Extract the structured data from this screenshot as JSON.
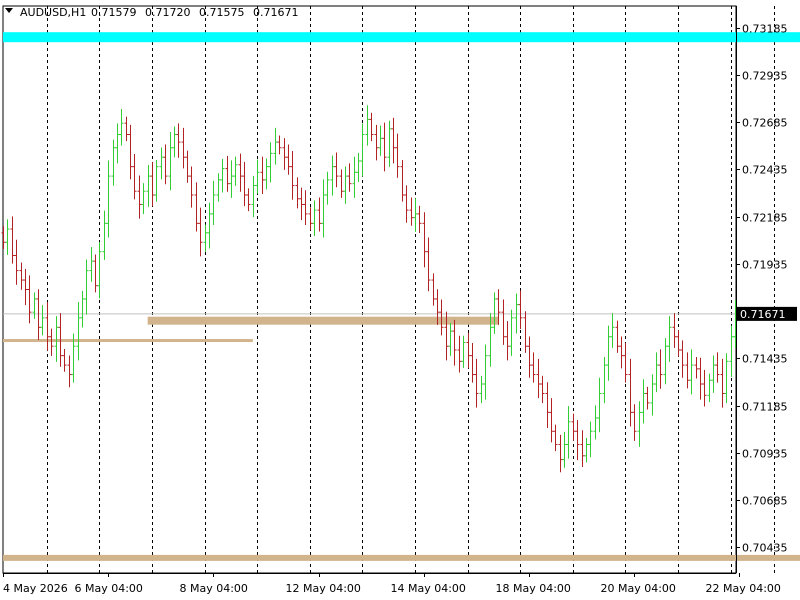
{
  "chart_data": {
    "type": "bar",
    "style": "ohlc-bars",
    "title": "AUDUSD,H1",
    "ohlc_header": {
      "open": "0.71579",
      "high": "0.71720",
      "low": "0.71575",
      "close": "0.71671"
    },
    "current_price": 0.71671,
    "current_price_label": "0.71671",
    "ylim": [
      0.703,
      0.733
    ],
    "y_ticks": [
      {
        "value": 0.73185,
        "label": "0.73185"
      },
      {
        "value": 0.72935,
        "label": "0.72935"
      },
      {
        "value": 0.72685,
        "label": "0.72685"
      },
      {
        "value": 0.72435,
        "label": "0.72435"
      },
      {
        "value": 0.72185,
        "label": "0.72185"
      },
      {
        "value": 0.71935,
        "label": "0.71935"
      },
      {
        "value": 0.71685,
        "label": "0.71685"
      },
      {
        "value": 0.71435,
        "label": "0.71435"
      },
      {
        "value": 0.71185,
        "label": "0.71185"
      },
      {
        "value": 0.70935,
        "label": "0.70935"
      },
      {
        "value": 0.70685,
        "label": "0.70685"
      },
      {
        "value": 0.70435,
        "label": "0.70435"
      }
    ],
    "x_ticks": [
      {
        "bar": 0,
        "label": "4 May 2026"
      },
      {
        "bar": 24,
        "label": "6 May 04:00"
      },
      {
        "bar": 48,
        "label": "8 May 04:00"
      },
      {
        "bar": 72,
        "label": "12 May 04:00"
      },
      {
        "bar": 96,
        "label": "14 May 04:00"
      },
      {
        "bar": 120,
        "label": "18 May 04:00"
      },
      {
        "bar": 144,
        "label": "20 May 04:00"
      },
      {
        "bar": 168,
        "label": "22 May 04:00"
      }
    ],
    "day_separators": [
      10,
      22,
      34,
      46,
      58,
      70,
      82,
      94,
      106,
      118,
      130,
      142,
      154,
      166,
      176
    ],
    "levels": [
      {
        "value": 0.73135,
        "color": "#00ffff",
        "from_bar": 0,
        "to_bar": 183
      },
      {
        "value": 0.71635,
        "color": "#d2b48c",
        "from_bar": 33,
        "to_bar": 113
      },
      {
        "value": 0.7153,
        "color": "#d2b48c",
        "from_bar": 0,
        "to_bar": 57
      },
      {
        "value": 0.7038,
        "color": "#d2b48c",
        "from_bar": 0,
        "to_bar": 183
      }
    ],
    "colors": {
      "up": "#32cd32",
      "down": "#b22222",
      "current_line": "#c0c0c0",
      "grid": "#000000"
    },
    "points": [
      [
        0.721,
        0.7205
      ],
      [
        0.7205,
        0.7212
      ],
      [
        0.7212,
        0.7198
      ],
      [
        0.7198,
        0.719
      ],
      [
        0.719,
        0.7185
      ],
      [
        0.7185,
        0.718
      ],
      [
        0.718,
        0.7168
      ],
      [
        0.7168,
        0.7175
      ],
      [
        0.7175,
        0.716
      ],
      [
        0.716,
        0.7165
      ],
      [
        0.7165,
        0.7155
      ],
      [
        0.7155,
        0.715
      ],
      [
        0.715,
        0.716
      ],
      [
        0.716,
        0.7145
      ],
      [
        0.7145,
        0.714
      ],
      [
        0.714,
        0.7135
      ],
      [
        0.7135,
        0.715
      ],
      [
        0.715,
        0.7165
      ],
      [
        0.7165,
        0.7175
      ],
      [
        0.7175,
        0.719
      ],
      [
        0.719,
        0.7195
      ],
      [
        0.7195,
        0.7182
      ],
      [
        0.7182,
        0.72
      ],
      [
        0.72,
        0.7215
      ],
      [
        0.7215,
        0.724
      ],
      [
        0.724,
        0.7255
      ],
      [
        0.7255,
        0.7262
      ],
      [
        0.7262,
        0.7268
      ],
      [
        0.7268,
        0.7262
      ],
      [
        0.7262,
        0.7245
      ],
      [
        0.7245,
        0.7232
      ],
      [
        0.7232,
        0.7225
      ],
      [
        0.7225,
        0.7232
      ],
      [
        0.7232,
        0.724
      ],
      [
        0.724,
        0.723
      ],
      [
        0.723,
        0.7245
      ],
      [
        0.7245,
        0.725
      ],
      [
        0.725,
        0.724
      ],
      [
        0.724,
        0.7255
      ],
      [
        0.7255,
        0.7262
      ],
      [
        0.7262,
        0.7258
      ],
      [
        0.7258,
        0.725
      ],
      [
        0.725,
        0.724
      ],
      [
        0.724,
        0.723
      ],
      [
        0.723,
        0.7215
      ],
      [
        0.7215,
        0.7205
      ],
      [
        0.7205,
        0.721
      ],
      [
        0.721,
        0.722
      ],
      [
        0.722,
        0.723
      ],
      [
        0.723,
        0.7238
      ],
      [
        0.7238,
        0.7244
      ],
      [
        0.7244,
        0.7236
      ],
      [
        0.7236,
        0.724
      ],
      [
        0.724,
        0.7246
      ],
      [
        0.7246,
        0.724
      ],
      [
        0.724,
        0.723
      ],
      [
        0.723,
        0.7225
      ],
      [
        0.7225,
        0.7235
      ],
      [
        0.7235,
        0.7242
      ],
      [
        0.7242,
        0.7238
      ],
      [
        0.7238,
        0.7245
      ],
      [
        0.7245,
        0.7252
      ],
      [
        0.7252,
        0.7258
      ],
      [
        0.7258,
        0.7255
      ],
      [
        0.7255,
        0.725
      ],
      [
        0.725,
        0.7245
      ],
      [
        0.7245,
        0.7235
      ],
      [
        0.7235,
        0.7228
      ],
      [
        0.7228,
        0.7225
      ],
      [
        0.7225,
        0.722
      ],
      [
        0.722,
        0.7215
      ],
      [
        0.7215,
        0.7222
      ],
      [
        0.7222,
        0.7215
      ],
      [
        0.7215,
        0.723
      ],
      [
        0.723,
        0.7238
      ],
      [
        0.7238,
        0.7245
      ],
      [
        0.7245,
        0.724
      ],
      [
        0.724,
        0.7232
      ],
      [
        0.7232,
        0.724
      ],
      [
        0.724,
        0.7236
      ],
      [
        0.7236,
        0.7242
      ],
      [
        0.7242,
        0.7248
      ],
      [
        0.7248,
        0.7262
      ],
      [
        0.7262,
        0.727
      ],
      [
        0.727,
        0.7262
      ],
      [
        0.7262,
        0.7255
      ],
      [
        0.7255,
        0.726
      ],
      [
        0.726,
        0.725
      ],
      [
        0.725,
        0.7265
      ],
      [
        0.7265,
        0.7255
      ],
      [
        0.7255,
        0.7245
      ],
      [
        0.7245,
        0.723
      ],
      [
        0.723,
        0.7222
      ],
      [
        0.7222,
        0.7218
      ],
      [
        0.7218,
        0.722
      ],
      [
        0.722,
        0.7215
      ],
      [
        0.7215,
        0.72
      ],
      [
        0.72,
        0.7185
      ],
      [
        0.7185,
        0.7175
      ],
      [
        0.7175,
        0.7168
      ],
      [
        0.7168,
        0.716
      ],
      [
        0.716,
        0.715
      ],
      [
        0.715,
        0.7158
      ],
      [
        0.7158,
        0.7148
      ],
      [
        0.7148,
        0.7142
      ],
      [
        0.7142,
        0.7152
      ],
      [
        0.7152,
        0.7145
      ],
      [
        0.7145,
        0.7135
      ],
      [
        0.7135,
        0.7125
      ],
      [
        0.7125,
        0.713
      ],
      [
        0.713,
        0.7145
      ],
      [
        0.7145,
        0.716
      ],
      [
        0.716,
        0.7175
      ],
      [
        0.7175,
        0.7168
      ],
      [
        0.7168,
        0.7155
      ],
      [
        0.7155,
        0.715
      ],
      [
        0.715,
        0.7165
      ],
      [
        0.7165,
        0.7172
      ],
      [
        0.7172,
        0.7165
      ],
      [
        0.7165,
        0.715
      ],
      [
        0.715,
        0.714
      ],
      [
        0.714,
        0.7135
      ],
      [
        0.7135,
        0.713
      ],
      [
        0.713,
        0.7125
      ],
      [
        0.7125,
        0.7115
      ],
      [
        0.7115,
        0.7105
      ],
      [
        0.7105,
        0.7098
      ],
      [
        0.7098,
        0.709
      ],
      [
        0.709,
        0.7098
      ],
      [
        0.7098,
        0.711
      ],
      [
        0.711,
        0.7105
      ],
      [
        0.7105,
        0.7098
      ],
      [
        0.7098,
        0.7092
      ],
      [
        0.7092,
        0.7098
      ],
      [
        0.7098,
        0.7105
      ],
      [
        0.7105,
        0.7112
      ],
      [
        0.7112,
        0.7125
      ],
      [
        0.7125,
        0.714
      ],
      [
        0.714,
        0.7155
      ],
      [
        0.7155,
        0.716
      ],
      [
        0.716,
        0.715
      ],
      [
        0.715,
        0.7145
      ],
      [
        0.7145,
        0.7135
      ],
      [
        0.7135,
        0.7115
      ],
      [
        0.7115,
        0.7105
      ],
      [
        0.7105,
        0.7115
      ],
      [
        0.7115,
        0.7125
      ],
      [
        0.7125,
        0.712
      ],
      [
        0.712,
        0.713
      ],
      [
        0.713,
        0.714
      ],
      [
        0.714,
        0.7135
      ],
      [
        0.7135,
        0.715
      ],
      [
        0.715,
        0.716
      ],
      [
        0.716,
        0.7155
      ],
      [
        0.7155,
        0.7148
      ],
      [
        0.7148,
        0.714
      ],
      [
        0.714,
        0.7132
      ],
      [
        0.7132,
        0.714
      ],
      [
        0.714,
        0.7138
      ],
      [
        0.7138,
        0.713
      ],
      [
        0.713,
        0.7124
      ],
      [
        0.7124,
        0.7132
      ],
      [
        0.7132,
        0.714
      ],
      [
        0.714,
        0.7135
      ],
      [
        0.7135,
        0.7125
      ],
      [
        0.7125,
        0.7142
      ],
      [
        0.7142,
        0.7155
      ],
      [
        0.7155,
        0.7167
      ]
    ],
    "points_format": "[open, close] per H1 bar in price units"
  }
}
